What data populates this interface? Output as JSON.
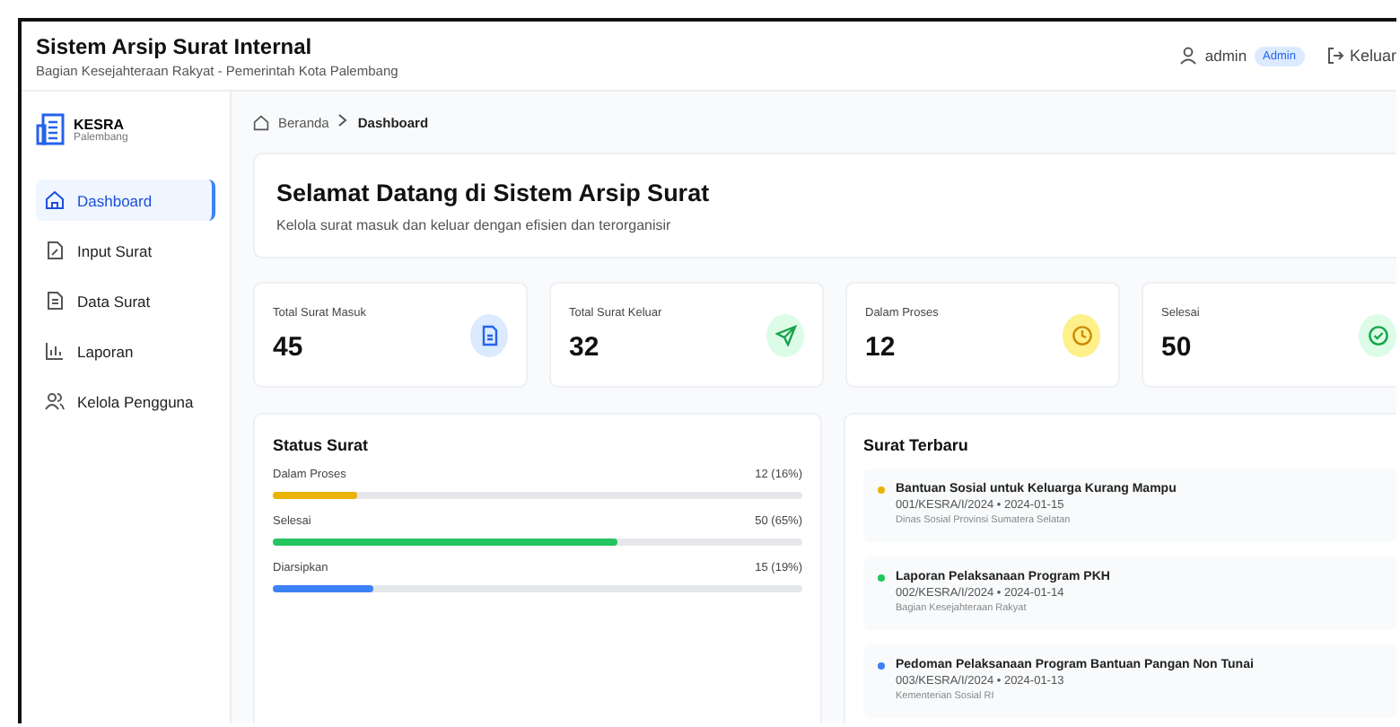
{
  "header": {
    "title": "Sistem Arsip Surat Internal",
    "subtitle": "Bagian Kesejahteraan Rakyat - Pemerintah Kota Palembang",
    "user": "admin",
    "role": "Admin",
    "logout": "Keluar"
  },
  "sidebar": {
    "brand": "KESRA",
    "brand_sub": "Palembang",
    "items": [
      {
        "label": "Dashboard",
        "kind": "home",
        "selected": true
      },
      {
        "label": "Input Surat",
        "kind": "input",
        "selected": false
      },
      {
        "label": "Data Surat",
        "kind": "data",
        "selected": false
      },
      {
        "label": "Laporan",
        "kind": "report",
        "selected": false
      },
      {
        "label": "Kelola Pengguna",
        "kind": "users",
        "selected": false
      }
    ]
  },
  "breadcrumb": [
    "Beranda",
    "Dashboard"
  ],
  "welcome": {
    "title": "Selamat Datang di Sistem Arsip Surat",
    "text": "Kelola surat masuk dan keluar dengan efisien dan terorganisir"
  },
  "stats": [
    {
      "label": "Total Surat Masuk",
      "value": "45",
      "kind": "incoming"
    },
    {
      "label": "Total Surat Keluar",
      "value": "32",
      "kind": "outgoing"
    },
    {
      "label": "Dalam Proses",
      "value": "12",
      "kind": "process"
    },
    {
      "label": "Selesai",
      "value": "50",
      "kind": "done"
    }
  ],
  "status": {
    "title": "Status Surat",
    "rows": [
      {
        "label": "Dalam Proses",
        "reading": "12 (16%)",
        "level": 0.16,
        "color": "#eab308"
      },
      {
        "label": "Selesai",
        "reading": "50 (65%)",
        "level": 0.65,
        "color": "#22c55e"
      },
      {
        "label": "Diarsipkan",
        "reading": "15 (19%)",
        "level": 0.19,
        "color": "#3b82f6"
      }
    ]
  },
  "recent": {
    "title": "Surat Terbaru",
    "items": [
      {
        "title": "Bantuan Sosial untuk Keluarga Kurang Mampu",
        "meta": "001/KESRA/I/2024 • 2024-01-15",
        "source": "Dinas Sosial Provinsi Sumatera Selatan",
        "color": "#eab308"
      },
      {
        "title": "Laporan Pelaksanaan Program PKH",
        "meta": "002/KESRA/I/2024 • 2024-01-14",
        "source": "Bagian Kesejahteraan Rakyat",
        "color": "#22c55e"
      },
      {
        "title": "Pedoman Pelaksanaan Program Bantuan Pangan Non Tunai",
        "meta": "003/KESRA/I/2024 • 2024-01-13",
        "source": "Kementerian Sosial RI",
        "color": "#3b82f6"
      }
    ]
  }
}
